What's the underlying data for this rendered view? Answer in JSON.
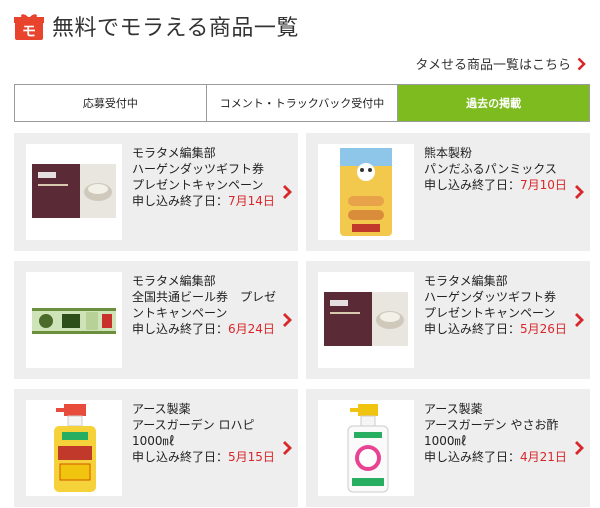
{
  "header": {
    "title": "無料でモラえる商品一覧",
    "icon_char": "モ"
  },
  "sub_link": {
    "label": "タメせる商品一覧はこちら"
  },
  "tabs": [
    {
      "label": "応募受付中",
      "active": false
    },
    {
      "label": "コメント・トラックバック受付中",
      "active": false
    },
    {
      "label": "過去の掲載",
      "active": true
    }
  ],
  "items": [
    {
      "maker": "モラタメ編集部",
      "title": "ハーゲンダッツギフト券 プレゼントキャンペーン",
      "deadline_prefix": "申し込み終了日：",
      "deadline_date": "7月14日",
      "thumb": "haagen-dazs-gift-card"
    },
    {
      "maker": "熊本製粉",
      "title": "パンだふるパンミックス",
      "deadline_prefix": "申し込み終了日：",
      "deadline_date": "7月10日",
      "thumb": "bread-mix-package"
    },
    {
      "maker": "モラタメ編集部",
      "title": "全国共通ビール券　プレゼントキャンペーン",
      "deadline_prefix": "申し込み終了日：",
      "deadline_date": "6月24日",
      "thumb": "beer-voucher"
    },
    {
      "maker": "モラタメ編集部",
      "title": "ハーゲンダッツギフト券 プレゼントキャンペーン",
      "deadline_prefix": "申し込み終了日：",
      "deadline_date": "5月26日",
      "thumb": "haagen-dazs-gift-card"
    },
    {
      "maker": "アース製薬",
      "title": "アースガーデン ロハピ 1000㎖",
      "deadline_prefix": "申し込み終了日：",
      "deadline_date": "5月15日",
      "thumb": "spray-bottle-yellow"
    },
    {
      "maker": "アース製薬",
      "title": "アースガーデン やさお酢 1000㎖",
      "deadline_prefix": "申し込み終了日：",
      "deadline_date": "4月21日",
      "thumb": "spray-bottle-white"
    }
  ],
  "colors": {
    "accent_red": "#d9262a",
    "active_tab_green": "#7dbb1f",
    "card_bg": "#eeeeee"
  }
}
